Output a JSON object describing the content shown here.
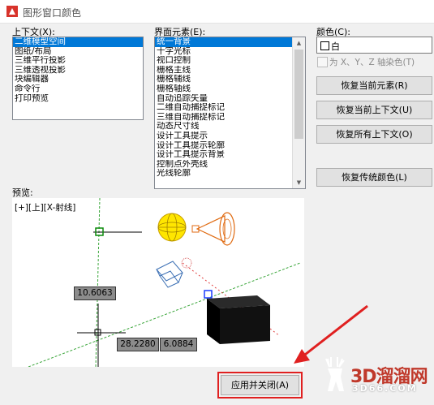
{
  "window": {
    "title": "图形窗口颜色"
  },
  "context": {
    "label": "上下文(X):",
    "items": [
      "二维模型空间",
      "图纸/布局",
      "三维平行投影",
      "三维透视投影",
      "块编辑器",
      "命令行",
      "打印预览"
    ],
    "selected_index": 0
  },
  "elements": {
    "label": "界面元素(E):",
    "items": [
      "统一背景",
      "十字光标",
      "视口控制",
      "栅格主线",
      "栅格辅线",
      "栅格轴线",
      "自动追踪矢量",
      "二维自动捕捉标记",
      "三维自动捕捉标记",
      "动态尺寸线",
      "设计工具提示",
      "设计工具提示轮廓",
      "设计工具提示背景",
      "控制点外壳线",
      "光线轮廓"
    ],
    "selected_index": 0
  },
  "color": {
    "label": "颜色(C):",
    "value": "白",
    "tint_checkbox": "为 X、Y、Z 轴染色(T)",
    "tint_checked": false
  },
  "buttons": {
    "restore_element": "恢复当前元素(R)",
    "restore_context": "恢复当前上下文(U)",
    "restore_all": "恢复所有上下文(O)",
    "restore_classic": "恢复传统颜色(L)",
    "apply_close": "应用并关闭(A)"
  },
  "preview": {
    "label": "预览:",
    "viewport_label": "[+][上][X-射线]",
    "coord_1": "10.6063",
    "coord_2": "28.2280",
    "coord_3": "6.0884"
  },
  "watermark": {
    "brand": "3D溜溜网",
    "url": "3D66.COM"
  },
  "colors": {
    "selection": "#0078d7",
    "highlight": "#e02020",
    "watermark": "#c0392b"
  }
}
